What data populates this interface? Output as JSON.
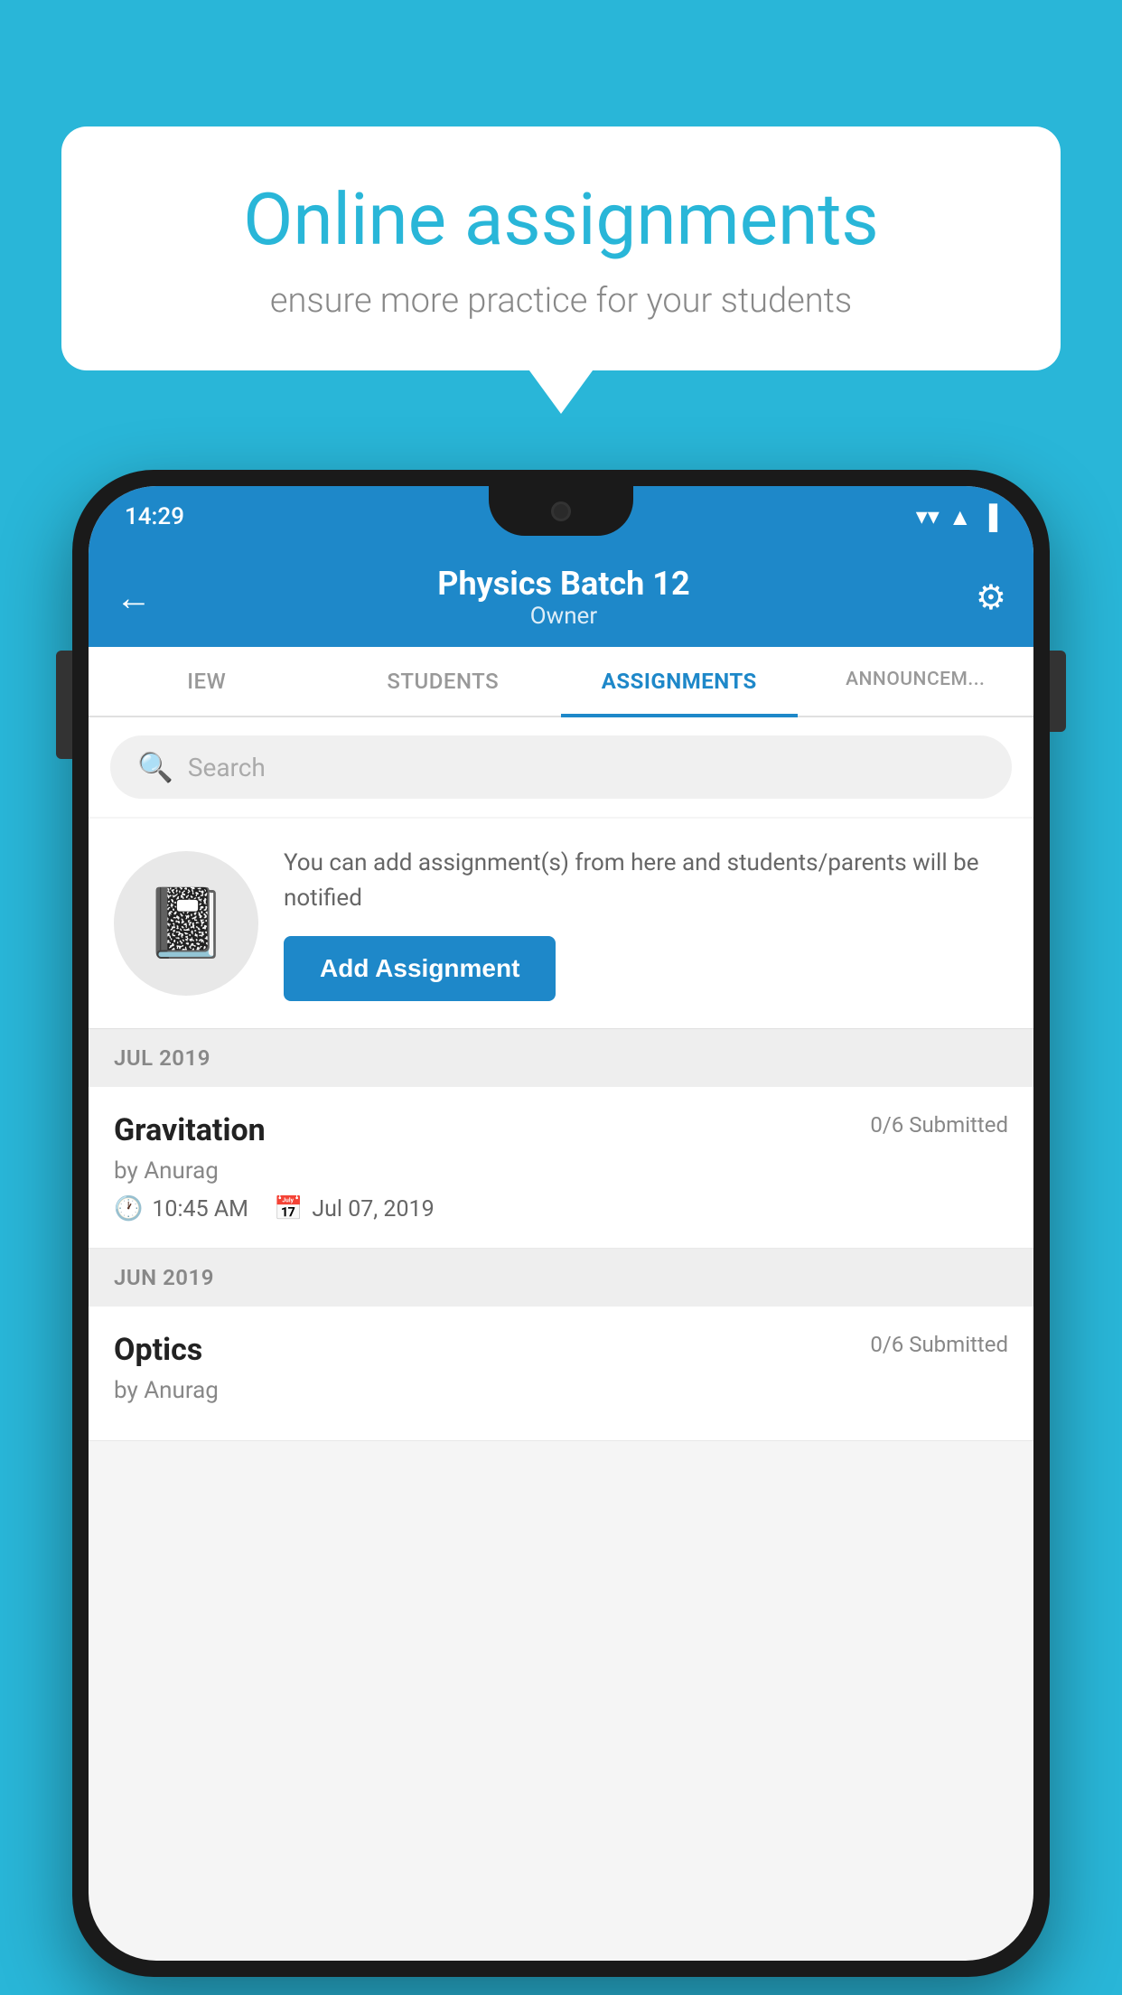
{
  "background_color": "#29B6D8",
  "speech_bubble": {
    "title": "Online assignments",
    "subtitle": "ensure more practice for your students"
  },
  "status_bar": {
    "time": "14:29",
    "wifi_icon": "▼",
    "signal_icon": "▲",
    "battery_icon": "▌"
  },
  "app_bar": {
    "back_icon": "←",
    "title": "Physics Batch 12",
    "subtitle": "Owner",
    "settings_icon": "⚙"
  },
  "tabs": [
    {
      "label": "IEW",
      "active": false
    },
    {
      "label": "STUDENTS",
      "active": false
    },
    {
      "label": "ASSIGNMENTS",
      "active": true
    },
    {
      "label": "ANNOUNCEM...",
      "active": false
    }
  ],
  "search": {
    "placeholder": "Search",
    "search_icon": "🔍"
  },
  "add_assignment_card": {
    "icon": "📓",
    "text": "You can add assignment(s) from here and students/parents will be notified",
    "button_label": "Add Assignment"
  },
  "sections": [
    {
      "month": "JUL 2019",
      "assignments": [
        {
          "name": "Gravitation",
          "submitted": "0/6 Submitted",
          "author": "by Anurag",
          "time": "10:45 AM",
          "date": "Jul 07, 2019"
        }
      ]
    },
    {
      "month": "JUN 2019",
      "assignments": [
        {
          "name": "Optics",
          "submitted": "0/6 Submitted",
          "author": "by Anurag",
          "time": "",
          "date": ""
        }
      ]
    }
  ]
}
